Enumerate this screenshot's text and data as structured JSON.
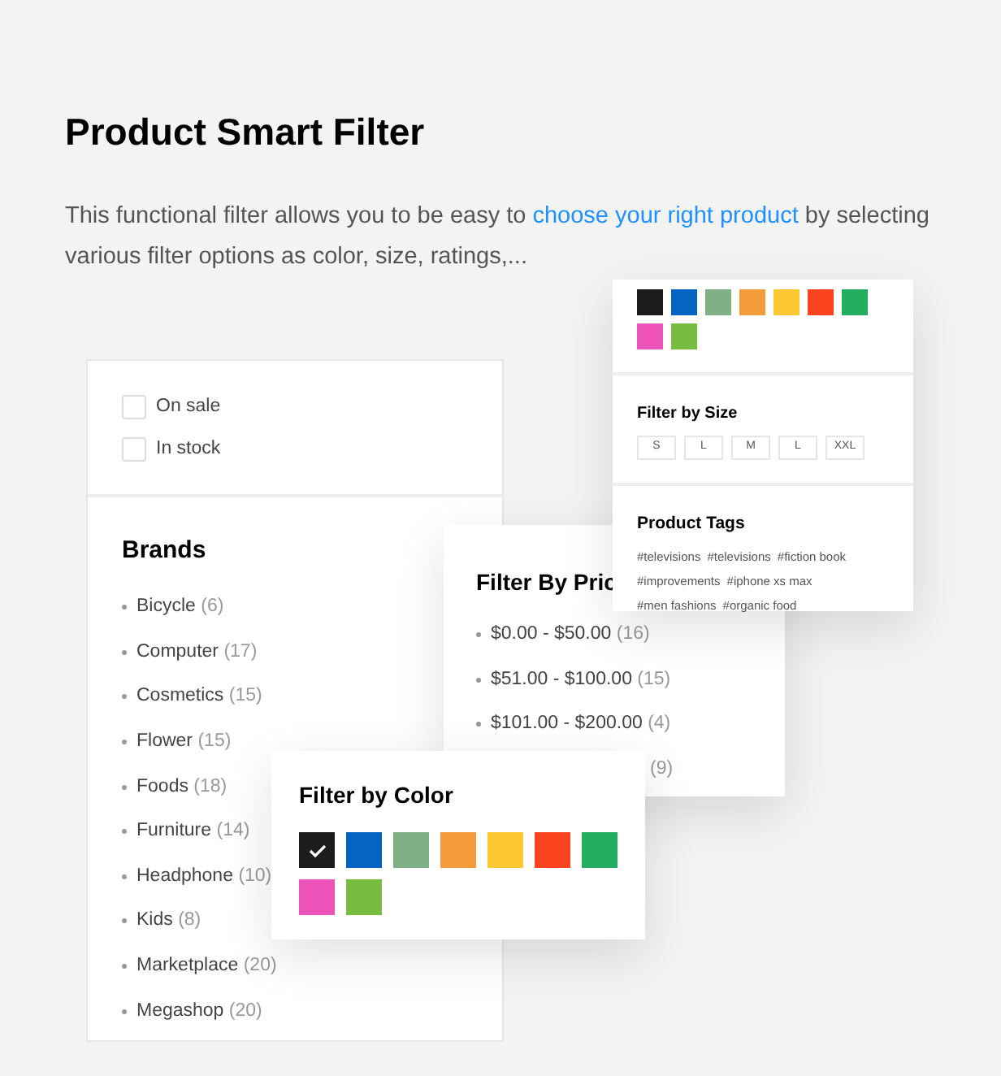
{
  "title": "Product Smart Filter",
  "intro": {
    "before": "This functional filter allows you to be easy to ",
    "link": "choose your right product",
    "after": " by selecting various filter options as color, size, ratings,..."
  },
  "options": [
    {
      "label": "On sale",
      "checked": false
    },
    {
      "label": "In stock",
      "checked": false
    }
  ],
  "brands": {
    "title": "Brands",
    "items": [
      {
        "name": "Bicycle",
        "count": "(6)"
      },
      {
        "name": "Computer",
        "count": "(17)"
      },
      {
        "name": "Cosmetics",
        "count": "(15)"
      },
      {
        "name": "Flower",
        "count": "(15)"
      },
      {
        "name": "Foods",
        "count": "(18)"
      },
      {
        "name": "Furniture",
        "count": "(14)"
      },
      {
        "name": "Headphone",
        "count": "(10)"
      },
      {
        "name": "Kids",
        "count": "(8)"
      },
      {
        "name": "Marketplace",
        "count": "(20)"
      },
      {
        "name": "Megashop",
        "count": "(20)"
      }
    ]
  },
  "price": {
    "title": "Filter By Pric",
    "items": [
      {
        "range": "$0.00 - $50.00",
        "count": "(16)"
      },
      {
        "range": "$51.00 - $100.00",
        "count": "(15)"
      },
      {
        "range": "$101.00 - $200.00",
        "count": "(4)"
      },
      {
        "count": "(9)"
      }
    ]
  },
  "color_filter": {
    "title": "Filter by Color",
    "swatches": [
      {
        "color": "#1c1c1c",
        "selected": true
      },
      {
        "color": "#0563c1",
        "selected": false
      },
      {
        "color": "#7db085",
        "selected": false
      },
      {
        "color": "#f49c3c",
        "selected": false
      },
      {
        "color": "#fec834",
        "selected": false
      },
      {
        "color": "#fd4421",
        "selected": false
      },
      {
        "color": "#24ae60",
        "selected": false
      },
      {
        "color": "#ec52b7",
        "selected": false
      },
      {
        "color": "#79bd40",
        "selected": false
      }
    ]
  },
  "side_card": {
    "swatches": [
      {
        "color": "#1c1c1c"
      },
      {
        "color": "#0563c1"
      },
      {
        "color": "#7db085"
      },
      {
        "color": "#f49c3c"
      },
      {
        "color": "#fec834"
      },
      {
        "color": "#fd4421"
      },
      {
        "color": "#24ae60"
      },
      {
        "color": "#ec52b7"
      },
      {
        "color": "#79bd40"
      }
    ],
    "size": {
      "title": "Filter by Size",
      "sizes": [
        "S",
        "L",
        "M",
        "L",
        "XXL"
      ]
    },
    "tags": {
      "title": "Product Tags",
      "tags": [
        "#televisions",
        "#televisions",
        "#fiction book",
        "#improvements",
        "#iphone xs max",
        "#men fashions",
        "#organic food"
      ]
    }
  }
}
